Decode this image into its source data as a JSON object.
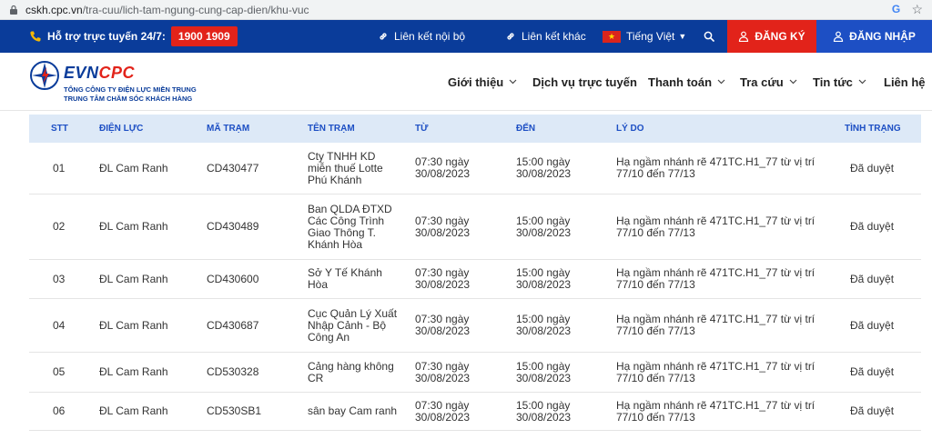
{
  "browser": {
    "url_domain": "cskh.cpc.vn",
    "url_path": "/tra-cuu/lich-tam-ngung-cung-cap-dien/khu-vuc"
  },
  "topbar": {
    "hotline_label": "Hỗ trợ trực tuyến 24/7:",
    "hotline_number": "1900 1909",
    "internal_links": "Liên kết nội bộ",
    "other_links": "Liên kết khác",
    "language": "Tiếng Việt",
    "register": "ĐĂNG KÝ",
    "login": "ĐĂNG NHẬP",
    "colors": {
      "bar": "#0a3c9a",
      "register_bg": "#e2231a",
      "login_bg": "#1d4fc4"
    }
  },
  "logo": {
    "brand_evn": "EVN",
    "brand_cpc": "CPC",
    "subtitle_1": "TỔNG CÔNG TY ĐIỆN LỰC MIỀN TRUNG",
    "subtitle_2": "TRUNG TÂM CHĂM SÓC KHÁCH HÀNG"
  },
  "nav": {
    "items": [
      {
        "label": "Giới thiệu",
        "has_dropdown": true
      },
      {
        "label": "Dịch vụ trực tuyến",
        "has_dropdown": false
      },
      {
        "label": "Thanh toán",
        "has_dropdown": true
      },
      {
        "label": "Tra cứu",
        "has_dropdown": true
      },
      {
        "label": "Tin tức",
        "has_dropdown": true
      },
      {
        "label": "Liên hệ",
        "has_dropdown": false
      }
    ]
  },
  "table": {
    "headers": {
      "stt": "STT",
      "dien_luc": "ĐIỆN LỰC",
      "ma_tram": "MÃ TRẠM",
      "ten_tram": "TÊN TRẠM",
      "tu": "TỪ",
      "den": "ĐẾN",
      "ly_do": "LÝ DO",
      "tinh_trang": "TÌNH TRẠNG"
    },
    "rows": [
      {
        "stt": "01",
        "dien_luc": "ĐL Cam Ranh",
        "ma_tram": "CD430477",
        "ten_tram": "Cty TNHH KD miễn thuế Lotte Phú Khánh",
        "tu": "07:30 ngày 30/08/2023",
        "den": "15:00 ngày 30/08/2023",
        "ly_do": "Hạ ngầm nhánh rẽ 471TC.H1_77 từ vị trí 77/10 đến 77/13",
        "tinh_trang": "Đã duyệt"
      },
      {
        "stt": "02",
        "dien_luc": "ĐL Cam Ranh",
        "ma_tram": "CD430489",
        "ten_tram": "Ban QLDA ĐTXD Các Công Trình Giao Thông T. Khánh Hòa",
        "tu": "07:30 ngày 30/08/2023",
        "den": "15:00 ngày 30/08/2023",
        "ly_do": "Hạ ngầm nhánh rẽ 471TC.H1_77 từ vị trí 77/10 đến 77/13",
        "tinh_trang": "Đã duyệt"
      },
      {
        "stt": "03",
        "dien_luc": "ĐL Cam Ranh",
        "ma_tram": "CD430600",
        "ten_tram": "Sở Y Tế Khánh Hòa",
        "tu": "07:30 ngày 30/08/2023",
        "den": "15:00 ngày 30/08/2023",
        "ly_do": "Hạ ngầm nhánh rẽ 471TC.H1_77 từ vị trí 77/10 đến 77/13",
        "tinh_trang": "Đã duyệt"
      },
      {
        "stt": "04",
        "dien_luc": "ĐL Cam Ranh",
        "ma_tram": "CD430687",
        "ten_tram": "Cục Quản Lý Xuất Nhập Cảnh - Bộ Công An",
        "tu": "07:30 ngày 30/08/2023",
        "den": "15:00 ngày 30/08/2023",
        "ly_do": "Hạ ngầm nhánh rẽ 471TC.H1_77 từ vị trí 77/10 đến 77/13",
        "tinh_trang": "Đã duyệt"
      },
      {
        "stt": "05",
        "dien_luc": "ĐL Cam Ranh",
        "ma_tram": "CD530328",
        "ten_tram": "Cảng hàng không CR",
        "tu": "07:30 ngày 30/08/2023",
        "den": "15:00 ngày 30/08/2023",
        "ly_do": "Hạ ngầm nhánh rẽ 471TC.H1_77 từ vị trí 77/10 đến 77/13",
        "tinh_trang": "Đã duyệt"
      },
      {
        "stt": "06",
        "dien_luc": "ĐL Cam Ranh",
        "ma_tram": "CD530SB1",
        "ten_tram": "sân bay Cam ranh",
        "tu": "07:30 ngày 30/08/2023",
        "den": "15:00 ngày 30/08/2023",
        "ly_do": "Hạ ngầm nhánh rẽ 471TC.H1_77 từ vị trí 77/10 đến 77/13",
        "tinh_trang": "Đã duyệt"
      }
    ]
  }
}
